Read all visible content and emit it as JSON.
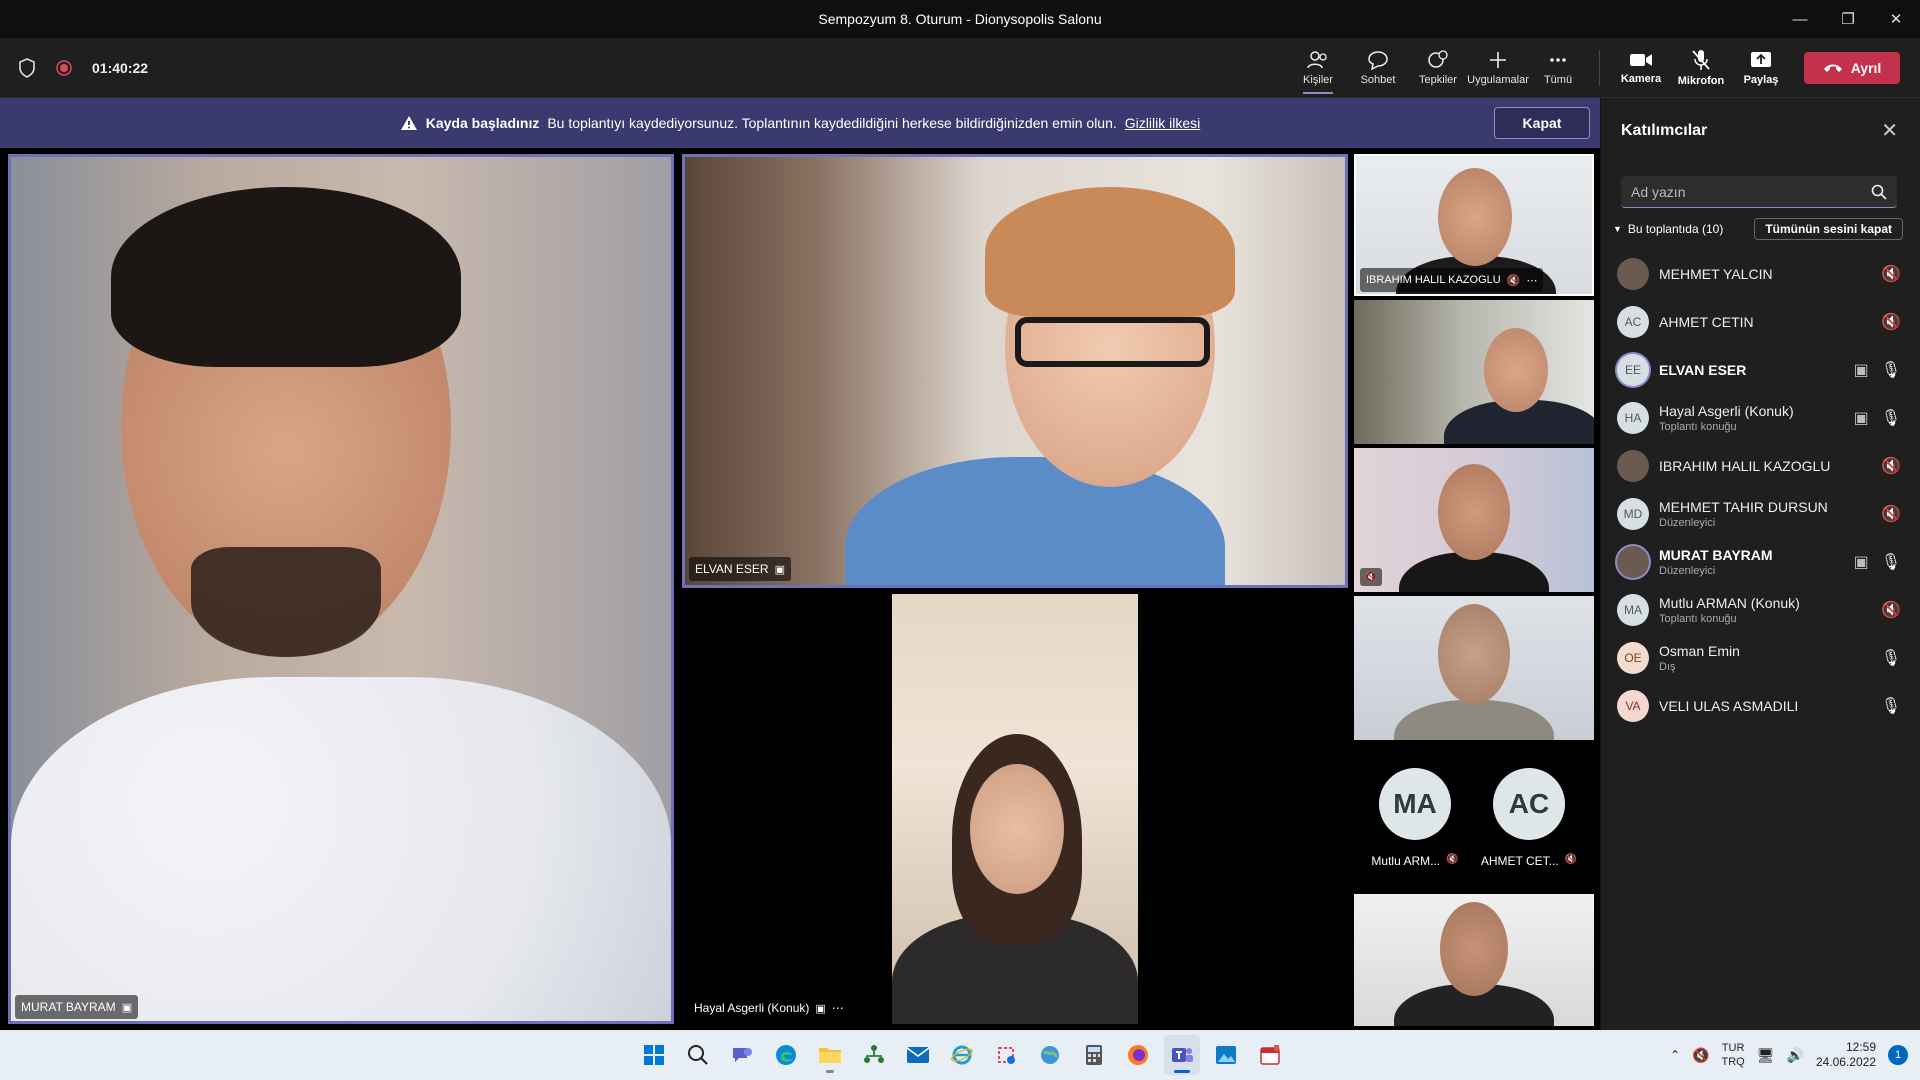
{
  "window": {
    "title": "Sempozyum 8. Oturum - Dionysopolis Salonu"
  },
  "toolbar": {
    "timer": "01:40:22",
    "people": "Kişiler",
    "chat": "Sohbet",
    "reactions": "Tepkiler",
    "apps": "Uygulamalar",
    "more": "Tümü",
    "camera": "Kamera",
    "mic": "Mikrofon",
    "share": "Paylaş",
    "leave": "Ayrıl"
  },
  "banner": {
    "title": "Kayda başladınız",
    "message": "Bu toplantıyı kaydediyorsunuz. Toplantının kaydedildiğini herkese bildirdiğinizden emin olun.",
    "link": "Gizlilik ilkesi",
    "close": "Kapat"
  },
  "stage": {
    "main": {
      "name": "MURAT BAYRAM"
    },
    "top": {
      "name": "ELVAN ESER"
    },
    "bottom": {
      "name": "Hayal Asgerli (Konuk)"
    },
    "side1": {
      "name": "IBRAHIM HALIL KAZOGLU"
    },
    "avatar1": {
      "initials": "MA",
      "name": "Mutlu ARM..."
    },
    "avatar2": {
      "initials": "AC",
      "name": "AHMET CET..."
    }
  },
  "panel": {
    "title": "Katılımcılar",
    "search_placeholder": "Ad yazın",
    "section": "Bu toplantıda (10)",
    "mute_all": "Tümünün sesini kapat",
    "participants": [
      {
        "initials": "",
        "name": "MEHMET YALCIN",
        "role": ""
      },
      {
        "initials": "AC",
        "name": "AHMET CETIN",
        "role": ""
      },
      {
        "initials": "EE",
        "name": "ELVAN ESER",
        "role": ""
      },
      {
        "initials": "HA",
        "name": "Hayal Asgerli (Konuk)",
        "role": "Toplantı konuğu"
      },
      {
        "initials": "",
        "name": "IBRAHIM HALIL KAZOGLU",
        "role": ""
      },
      {
        "initials": "MD",
        "name": "MEHMET TAHIR DURSUN",
        "role": "Düzenleyici"
      },
      {
        "initials": "",
        "name": "MURAT BAYRAM",
        "role": "Düzenleyici"
      },
      {
        "initials": "MA",
        "name": "Mutlu ARMAN (Konuk)",
        "role": "Toplantı konuğu"
      },
      {
        "initials": "OE",
        "name": "Osman Emin",
        "role": "Dış"
      },
      {
        "initials": "VA",
        "name": "VELI ULAS ASMADILI",
        "role": ""
      }
    ]
  },
  "taskbar": {
    "lang1": "TUR",
    "lang2": "TRQ",
    "time": "12:59",
    "date": "24.06.2022",
    "notifications": "1"
  },
  "colors": {
    "accent": "#8b8cc7",
    "leave": "#c4314b",
    "banner": "#3b3a6e"
  }
}
